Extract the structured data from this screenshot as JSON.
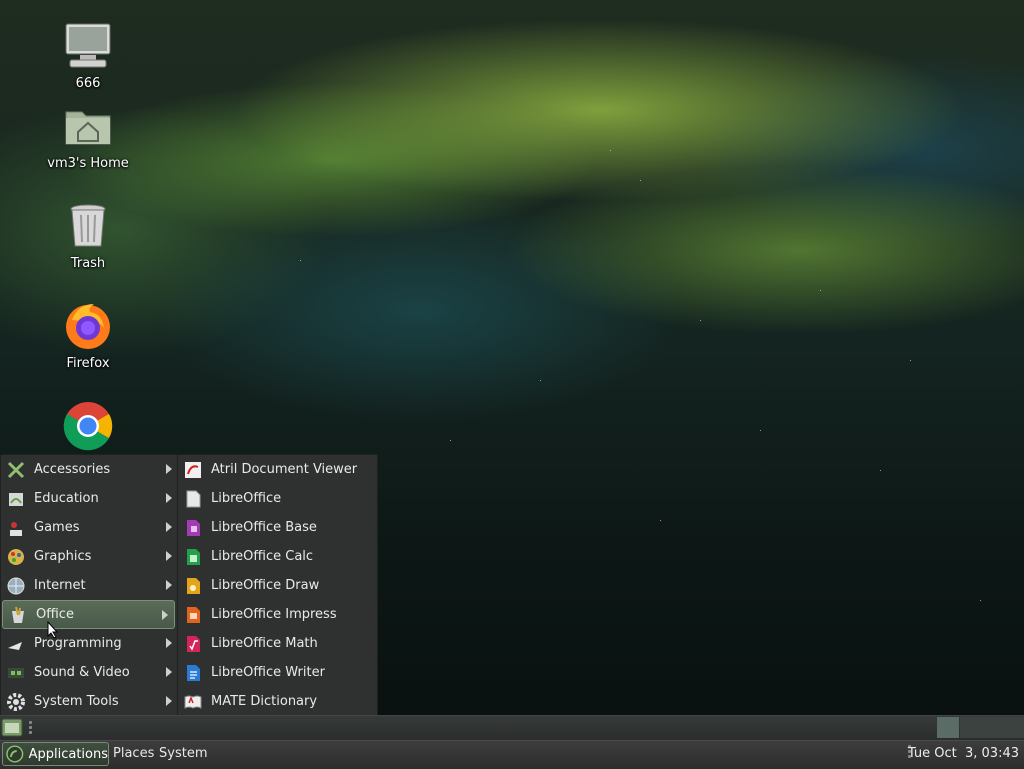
{
  "desktop": {
    "icons": [
      {
        "label": "666",
        "icon": "computer-icon"
      },
      {
        "label": "vm3's Home",
        "icon": "home-folder-icon"
      },
      {
        "label": "Trash",
        "icon": "trash-icon"
      },
      {
        "label": "Firefox",
        "icon": "firefox-icon"
      },
      {
        "label": "",
        "icon": "chrome-icon"
      }
    ]
  },
  "menu": {
    "categories": [
      {
        "label": "Accessories",
        "icon": "accessories-icon"
      },
      {
        "label": "Education",
        "icon": "education-icon"
      },
      {
        "label": "Games",
        "icon": "games-icon"
      },
      {
        "label": "Graphics",
        "icon": "graphics-icon"
      },
      {
        "label": "Internet",
        "icon": "internet-icon"
      },
      {
        "label": "Office",
        "icon": "office-icon",
        "selected": true
      },
      {
        "label": "Programming",
        "icon": "programming-icon"
      },
      {
        "label": "Sound & Video",
        "icon": "sound-video-icon"
      },
      {
        "label": "System Tools",
        "icon": "system-tools-icon"
      }
    ],
    "office_items": [
      {
        "label": "Atril Document Viewer",
        "icon": "atril-icon"
      },
      {
        "label": "LibreOffice",
        "icon": "libreoffice-icon"
      },
      {
        "label": "LibreOffice Base",
        "icon": "libreoffice-base-icon"
      },
      {
        "label": "LibreOffice Calc",
        "icon": "libreoffice-calc-icon"
      },
      {
        "label": "LibreOffice Draw",
        "icon": "libreoffice-draw-icon"
      },
      {
        "label": "LibreOffice Impress",
        "icon": "libreoffice-impress-icon"
      },
      {
        "label": "LibreOffice Math",
        "icon": "libreoffice-math-icon"
      },
      {
        "label": "LibreOffice Writer",
        "icon": "libreoffice-writer-icon"
      },
      {
        "label": "MATE Dictionary",
        "icon": "dictionary-icon"
      }
    ]
  },
  "panel": {
    "applications_label": "Applications",
    "places_label": "Places",
    "system_label": "System",
    "clock": "Tue Oct  3, 03:43"
  },
  "colors": {
    "menu_bg": "#2f3130",
    "selection": "#5a6d57",
    "panel_bg": "#333333"
  }
}
